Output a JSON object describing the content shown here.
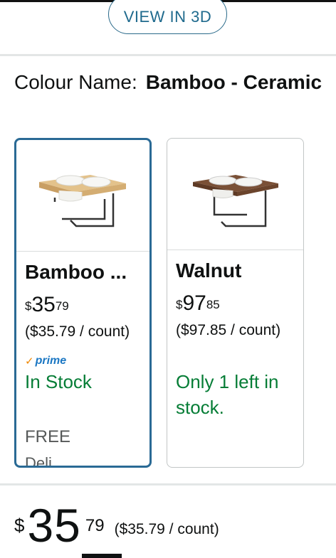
{
  "view_in_3d": "VIEW IN 3D",
  "colour": {
    "label": "Colour Name:",
    "value": "Bamboo - Ceramic"
  },
  "options": [
    {
      "name": "Bamboo ...",
      "price_symbol": "$",
      "price_whole": "35",
      "price_fraction": "79",
      "unit_price": "($35.79 / count)",
      "prime_label": "prime",
      "stock": "In Stock",
      "free": "FREE",
      "delivery": "Deli..."
    },
    {
      "name": "Walnut",
      "price_symbol": "$",
      "price_whole": "97",
      "price_fraction": "85",
      "unit_price": "($97.85 / count)",
      "stock": "Only 1 left in stock."
    }
  ],
  "selected_price": {
    "symbol": "$",
    "whole": "35",
    "fraction": "79",
    "unit_price": "($35.79 / count)"
  },
  "colors": {
    "accent_blue": "#2a6a95",
    "in_stock_green": "#067d36",
    "prime_blue": "#1b77c3"
  }
}
